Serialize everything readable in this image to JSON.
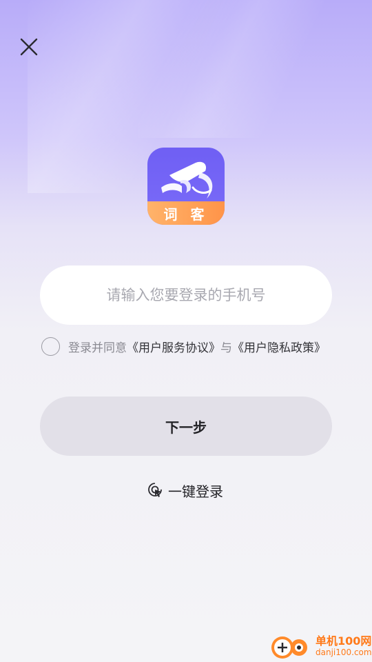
{
  "login": {
    "phone_placeholder": "请输入您要登录的手机号",
    "agreement_prefix": "登录并同意",
    "service_agreement": "《用户服务协议》",
    "agreement_and": "与",
    "privacy_policy": "《用户隐私政策》",
    "next_label": "下一步",
    "quick_login_label": "一键登录"
  },
  "app": {
    "logo_text": "词 客"
  },
  "watermark": {
    "title": "单机100网",
    "url": "danji100.com"
  },
  "icons": {
    "close": "close-icon",
    "quick_login": "touch-icon",
    "watermark": "watermark-logo"
  },
  "colors": {
    "accent": "#7768f7",
    "logo_band": "#ff9449",
    "button_bg": "#e2e0e8",
    "watermark": "#ff7a1a"
  }
}
